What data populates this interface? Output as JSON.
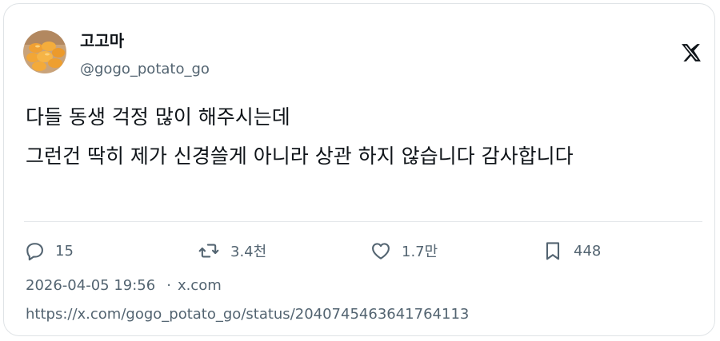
{
  "author": {
    "display_name": "고고마",
    "handle": "@gogo_potato_go",
    "avatar_icon": "avatar-fried-potatoes"
  },
  "platform": {
    "logo_icon": "x-logo-icon"
  },
  "tweet": {
    "lines": [
      "다들 동생 걱정 많이 해주시는데",
      "그런건 딱히 제가 신경쓸게 아니라 상관 하지 않습니다 감사합니다"
    ]
  },
  "actions": {
    "replies": {
      "icon": "reply-icon",
      "count": "15"
    },
    "retweets": {
      "icon": "retweet-icon",
      "count": "3.4천"
    },
    "likes": {
      "icon": "heart-icon",
      "count": "1.7만"
    },
    "bookmarks": {
      "icon": "bookmark-icon",
      "count": "448"
    }
  },
  "meta": {
    "timestamp": "2026-04-05 19:56",
    "separator": "·",
    "source": "x.com",
    "url": "https://x.com/gogo_potato_go/status/2040745463641764113"
  },
  "colors": {
    "text_primary": "#0f1419",
    "text_secondary": "#536471",
    "border": "#dfe3e6"
  }
}
